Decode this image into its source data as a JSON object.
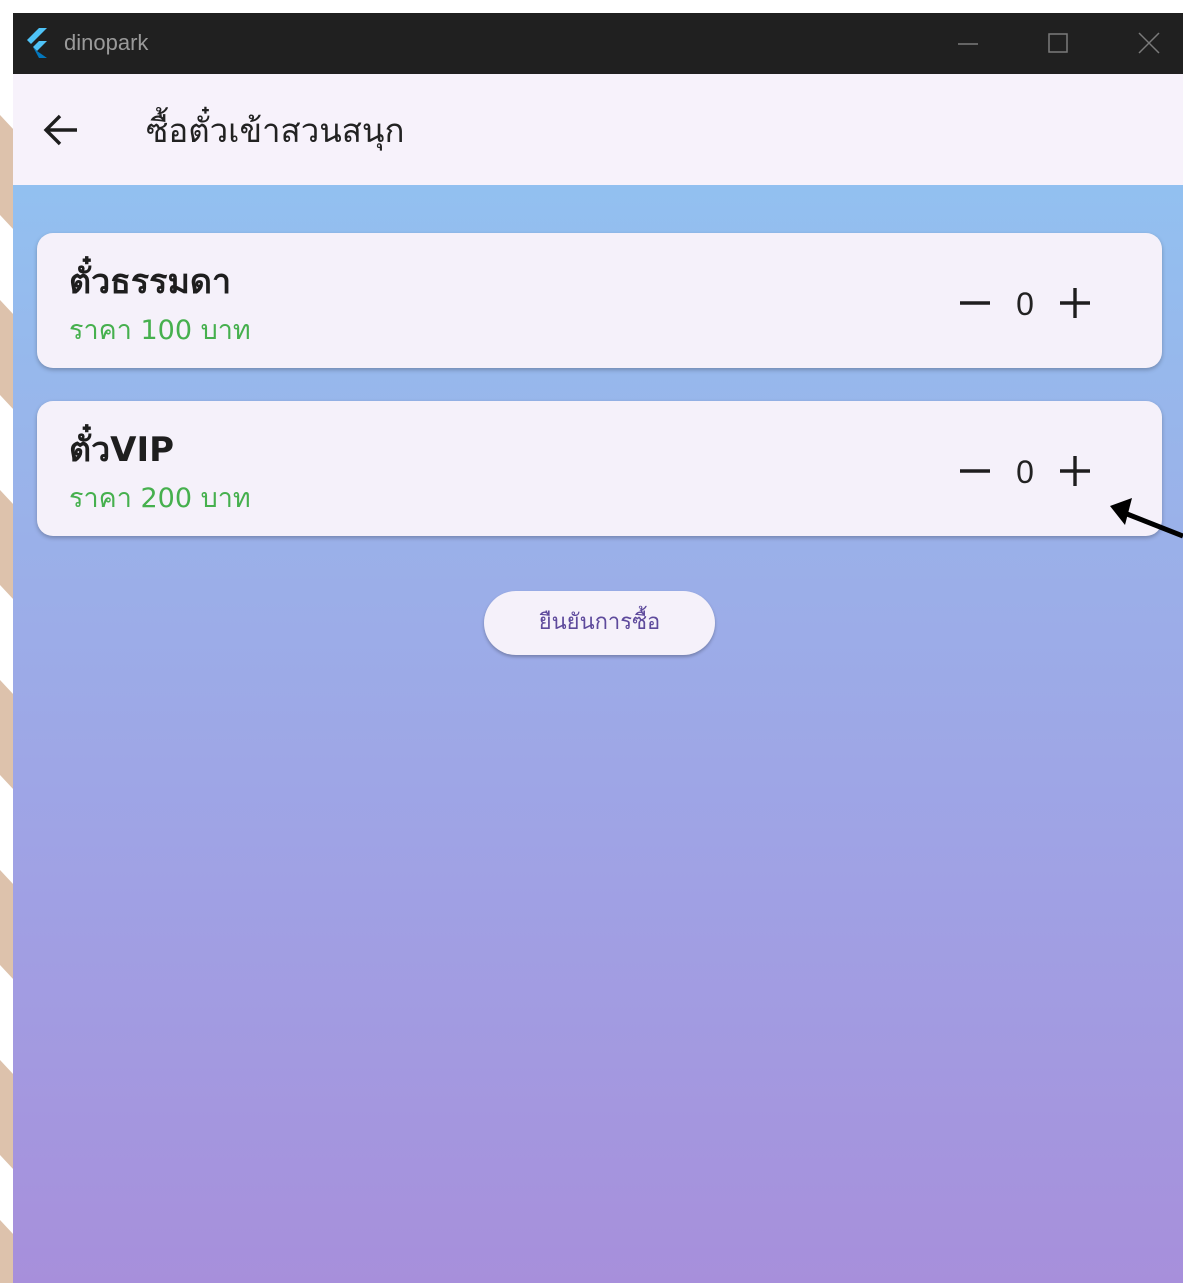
{
  "window": {
    "app_title": "dinopark",
    "logo_icon": "flutter-logo-icon",
    "controls": [
      "minimize-icon",
      "maximize-icon",
      "close-icon"
    ]
  },
  "appbar": {
    "back_icon": "arrow-left-icon",
    "title": "ซื้อตั๋วเข้าสวนสนุก"
  },
  "tickets": [
    {
      "name": "ตั๋วธรรมดา",
      "price": "ราคา 100 บาท",
      "quantity": "0"
    },
    {
      "name": "ตั๋วVIP",
      "price": "ราคา 200 บาท",
      "quantity": "0"
    }
  ],
  "confirm_button": {
    "label": "ยืนยันการซื้อ"
  },
  "colors": {
    "titlebar": "#202020",
    "appbar": "#f7f2fb",
    "gradient_top": "#8ec8f4",
    "gradient_bottom": "#a78fdb",
    "card": "#f5f1fa",
    "price_text": "#46b04e",
    "button_text": "#5e4a9c"
  }
}
